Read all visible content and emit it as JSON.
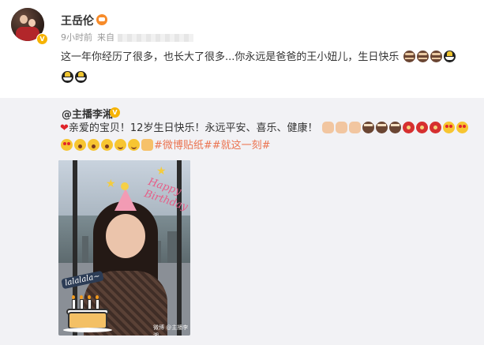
{
  "post": {
    "username": "王岳伦",
    "time": "9小时前",
    "source_prefix": "来自",
    "text": "这一年你经历了很多，也长大了很多...你永远是爸爸的王小妞儿，生日快乐",
    "badge": "V"
  },
  "repost": {
    "username": "@主播李湘",
    "badge": "V",
    "heart": "❤",
    "text": "亲爱的宝贝！12岁生日快乐！永远平安、喜乐、健康！",
    "topics": "#微博贴纸##就这一刻#"
  },
  "photo": {
    "greeting": "Happy Birthday",
    "sticker": "lalalala~",
    "watermark": "微博 @主播李湘"
  },
  "icons": {
    "emoji_cake": "cake-emoji",
    "emoji_fan": "cheer-emoji",
    "vip": "crown-icon"
  }
}
